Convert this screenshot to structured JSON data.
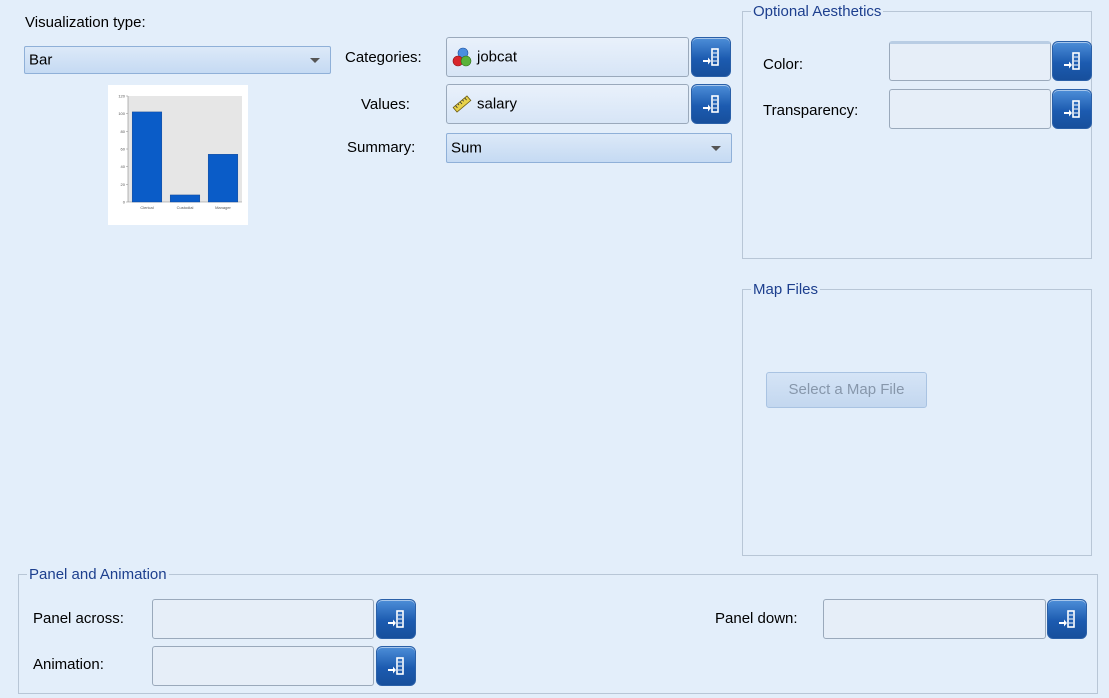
{
  "viz": {
    "label": "Visualization type:",
    "selected": "Bar"
  },
  "fields": {
    "categories": {
      "label": "Categories:",
      "value": "jobcat",
      "icon": "nominal-variable-icon"
    },
    "values": {
      "label": "Values:",
      "value": "salary",
      "icon": "scale-variable-icon"
    },
    "summary": {
      "label": "Summary:",
      "selected": "Sum"
    }
  },
  "aesthetics": {
    "legend": "Optional Aesthetics",
    "color_label": "Color:",
    "color_value": "",
    "transparency_label": "Transparency:",
    "transparency_value": ""
  },
  "map_files": {
    "legend": "Map Files",
    "button": "Select a Map File"
  },
  "panel": {
    "legend": "Panel and Animation",
    "across_label": "Panel across:",
    "across_value": "",
    "down_label": "Panel down:",
    "down_value": "",
    "animation_label": "Animation:",
    "animation_value": ""
  },
  "colors": {
    "background": "#e3eefa",
    "accent_button": "#1c5bb0",
    "legend_text": "#1d3f8e",
    "bar_fill": "#0a5cc8"
  },
  "chart_data": {
    "type": "bar",
    "categories": [
      "Clerical",
      "Custodial",
      "Manager"
    ],
    "values": [
      102,
      8,
      54
    ],
    "ylim": [
      0,
      120
    ],
    "yticks": [
      "0",
      "20",
      "40",
      "60",
      "80",
      "100",
      "120"
    ]
  }
}
